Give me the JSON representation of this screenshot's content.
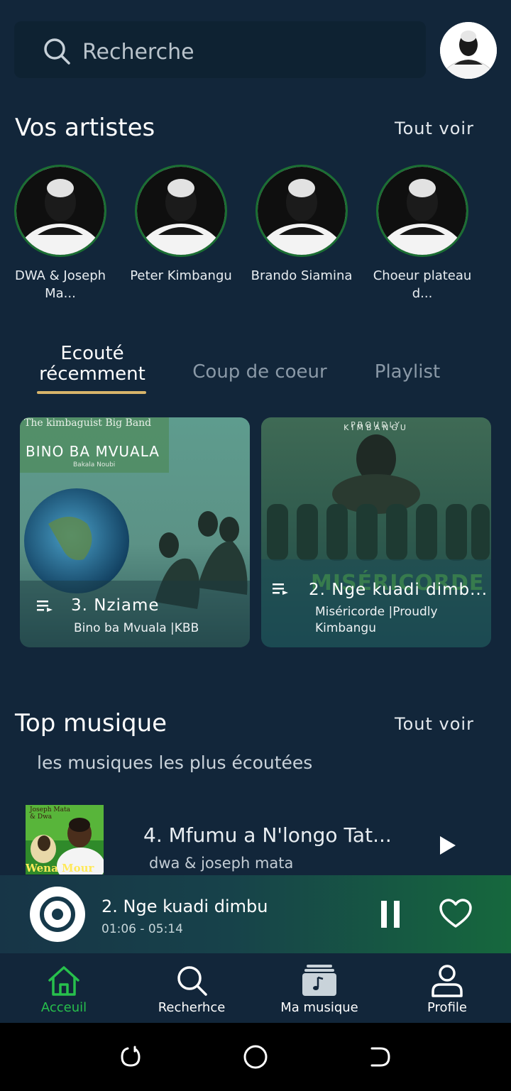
{
  "search": {
    "placeholder": "Recherche"
  },
  "artists_section": {
    "title": "Vos artistes",
    "see_all": "Tout voir",
    "artists": [
      {
        "name": "DWA & Joseph Ma..."
      },
      {
        "name": "Peter Kimbangu"
      },
      {
        "name": "Brando Siamina"
      },
      {
        "name": "Choeur plateau d..."
      }
    ]
  },
  "tabs": [
    {
      "label": "Ecouté récemment",
      "active": true
    },
    {
      "label": "Coup de coeur",
      "active": false
    },
    {
      "label": "Playlist",
      "active": false
    }
  ],
  "recent_cards": [
    {
      "cover_text_top": "The kimbaguist Big Band",
      "cover_text_mid": "BINO BA MVUALA",
      "cover_text_small": "Bakala Noubi",
      "title": "3. Nziame",
      "subtitle": "Bino ba Mvuala  |KBB"
    },
    {
      "cover_text_top": "PROUDLY",
      "cover_text_mid": "KIMBANGU",
      "cover_text_small": "MISÉRICORDE",
      "title": "2. Nge kuadi dimb...",
      "subtitle": "Miséricorde  |Proudly Kimbangu"
    }
  ],
  "top_section": {
    "title": "Top musique",
    "see_all": "Tout voir",
    "subtitle": "les musiques les plus écoutées",
    "tracks": [
      {
        "title": "4. Mfumu a N'longo Tat...",
        "artist": "dwa & joseph mata",
        "cover_text_top": "Joseph Mata & Dwa",
        "cover_text_bottom": "Wena Mour"
      }
    ]
  },
  "player": {
    "title": "2. Nge kuadi dimbu",
    "time": "01:06 - 05:14"
  },
  "nav": [
    {
      "label": "Acceuil",
      "icon": "home-icon",
      "active": true
    },
    {
      "label": "Recherhce",
      "icon": "search-icon",
      "active": false
    },
    {
      "label": "Ma musique",
      "icon": "music-library-icon",
      "active": false
    },
    {
      "label": "Profile",
      "icon": "profile-icon",
      "active": false
    }
  ],
  "colors": {
    "background": "#12263a",
    "accent_green": "#27c04c",
    "tab_underline": "#d7b46a",
    "artist_ring": "#1b6f33"
  }
}
